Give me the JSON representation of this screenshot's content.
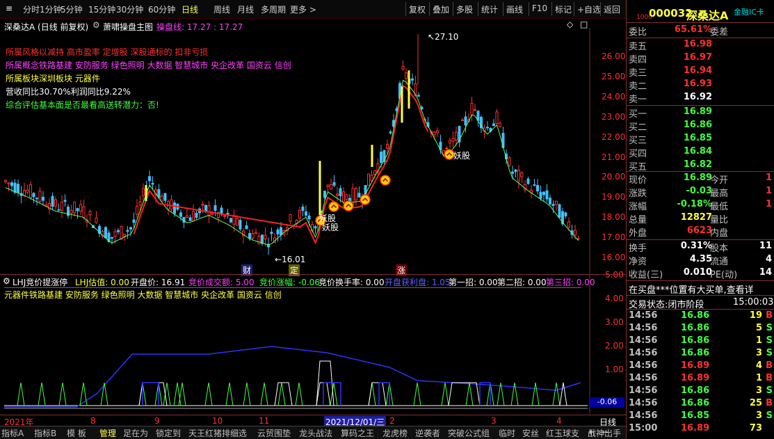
{
  "toolbar": {
    "periods": [
      "分时",
      "1分钟",
      "5分钟",
      "15分钟",
      "30分钟",
      "60分钟",
      "日线",
      "周线",
      "月线",
      "多周期",
      "更多 >"
    ],
    "active_period": "日线",
    "right_buttons": [
      "复权",
      "叠加",
      "多股",
      "统计",
      "画线",
      "F10",
      "标记",
      "+自选",
      "返回"
    ]
  },
  "main": {
    "title": "深桑达A",
    "mode": "(日线 前复权)",
    "indicator_name": "萧啸操盘主图",
    "line_label": "操盘线: 17.27 : 17.27",
    "info_lines": [
      {
        "text": "所属风格以减持 高市盈率 定增股 深股通标的 扣非亏损",
        "color": "red"
      },
      {
        "text": "所属概念铁路基建 安防服务 绿色照明 大数据 智慧城市 央企改革 国资云 信创",
        "color": "mag"
      },
      {
        "text": "所属板块深圳板块  元器件",
        "color": "yel"
      },
      {
        "text": "营收同比30.70%利润同比9.22%",
        "color": "wht"
      },
      {
        "text": "综合评估基本面是否最看高送转潜力：否!",
        "color": "grn"
      }
    ],
    "annotations": {
      "high": "27.10",
      "low": "16.01",
      "yao1": "妖股",
      "yao2": "妖股",
      "yao3": "妖股"
    },
    "markers": [
      "财",
      "定",
      "涨"
    ],
    "y_labels": [
      "26.00",
      "25.00",
      "24.00",
      "23.00",
      "22.00",
      "21.00",
      "20.00",
      "19.00",
      "18.00",
      "17.00",
      "16.00"
    ]
  },
  "sub": {
    "title": "LHJ竞价提涨停",
    "fields": [
      {
        "text": "LHJ估值: 0.00",
        "color": "yel"
      },
      {
        "text": "开盘价: 16.91",
        "color": "wht"
      },
      {
        "text": "竞价成交额: 5.00",
        "color": "mag"
      },
      {
        "text": "竞价涨幅: -0.06",
        "color": "grn"
      },
      {
        "text": "竞价换手率: 0.00",
        "color": "wht"
      },
      {
        "text": "开盘获利盘: 1.05",
        "color": "blu"
      },
      {
        "text": "第一招: 0.00",
        "color": "wht"
      },
      {
        "text": "第二招: 0.00",
        "color": "wht"
      },
      {
        "text": "第三招: 0.00",
        "color": "mag"
      }
    ],
    "concepts": "元器件铁路基建 安防服务 绿色照明 大数据 智慧城市 央企改革 国资云 信创",
    "y_labels": [
      "5.00",
      "4.00",
      "3.00",
      "2.00",
      "1.00"
    ],
    "cur_value": "-0.06"
  },
  "timeaxis": {
    "labels": [
      "2021年",
      "8",
      "9",
      "10",
      "11",
      "2021/12/01/三",
      "2",
      "3",
      "4"
    ],
    "period": "日线"
  },
  "bottom_tabs": [
    "指标A",
    "指标B",
    "模 板",
    "管理",
    "足在为",
    "锁定到",
    "天王红猪排细选",
    "云贸围垫",
    "龙头战法",
    "算码之王",
    "龙虎榜",
    "逆袭者",
    "突破公式组",
    "临时",
    "安丝",
    "红玉球支",
    "战神出手"
  ],
  "quote": {
    "code_tag": "1000",
    "code": "000032",
    "name": "深桑达A",
    "card": "金融IC卡",
    "weibi_label": "委比",
    "weibi": "65.61%",
    "weicha_label": "委差",
    "asks": [
      {
        "label": "卖五",
        "price": "16.98"
      },
      {
        "label": "卖四",
        "price": "16.97"
      },
      {
        "label": "卖三",
        "price": "16.94"
      },
      {
        "label": "卖二",
        "price": "16.93"
      },
      {
        "label": "卖一",
        "price": "16.92"
      }
    ],
    "bids": [
      {
        "label": "买一",
        "price": "16.89"
      },
      {
        "label": "买二",
        "price": "16.86"
      },
      {
        "label": "买三",
        "price": "16.85"
      },
      {
        "label": "买四",
        "price": "16.84"
      },
      {
        "label": "买五",
        "price": "16.82"
      }
    ],
    "stats": [
      {
        "l": "现价",
        "v": "16.89",
        "c": "grn",
        "l2": "今开",
        "v2": "1"
      },
      {
        "l": "涨跌",
        "v": "-0.03",
        "c": "grn",
        "l2": "最高",
        "v2": "1"
      },
      {
        "l": "涨幅",
        "v": "-0.18%",
        "c": "grn",
        "l2": "最低",
        "v2": "1"
      },
      {
        "l": "总量",
        "v": "12827",
        "c": "yel",
        "l2": "量比",
        "v2": ""
      },
      {
        "l": "外盘",
        "v": "6623",
        "c": "red",
        "l2": "内盘",
        "v2": ""
      }
    ],
    "stats2": [
      {
        "l": "换手",
        "v": "0.31%",
        "l2": "股本",
        "v2": "11"
      },
      {
        "l": "净资",
        "v": "4.35",
        "l2": "流通",
        "v2": "4"
      },
      {
        "l": "收益(三)",
        "v": "0.010",
        "l2": "PE(动)",
        "v2": "14"
      }
    ],
    "marquee": "在买盘***位置有大买单,查看详",
    "status_label": "交易状态:",
    "status": "闭市阶段",
    "status_time": "15:00:03",
    "ticks": [
      {
        "t": "14:56",
        "p": "16.86",
        "v": "19",
        "bs": "B"
      },
      {
        "t": "14:56",
        "p": "16.86",
        "v": "5",
        "bs": "S"
      },
      {
        "t": "14:56",
        "p": "16.86",
        "v": "1",
        "bs": "S"
      },
      {
        "t": "14:56",
        "p": "16.86",
        "v": "3",
        "bs": "S"
      },
      {
        "t": "14:56",
        "p": "16.89",
        "v": "4",
        "bs": "B"
      },
      {
        "t": "14:56",
        "p": "16.89",
        "v": "1",
        "bs": "B"
      },
      {
        "t": "14:56",
        "p": "16.86",
        "v": "3",
        "bs": "S"
      },
      {
        "t": "14:56",
        "p": "16.86",
        "v": "25",
        "bs": "B"
      },
      {
        "t": "14:56",
        "p": "16.85",
        "v": "3",
        "bs": "S"
      },
      {
        "t": "15:00",
        "p": "16.89",
        "v": "73",
        "bs": ""
      }
    ]
  }
}
